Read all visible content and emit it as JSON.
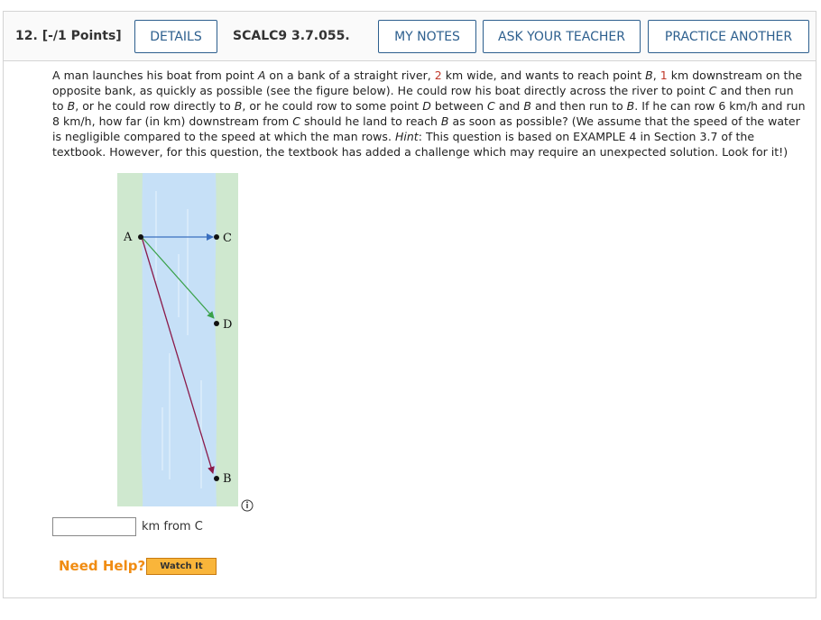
{
  "header": {
    "question_number": "12.",
    "points": "[-/1 Points]",
    "details_label": "DETAILS",
    "problem_code": "SCALC9 3.7.055.",
    "my_notes_label": "MY NOTES",
    "ask_teacher_label": "ASK YOUR TEACHER",
    "practice_label": "PRACTICE ANOTHER"
  },
  "question": {
    "p1": "A man launches his boat from point ",
    "pt_A": "A",
    "p2": " on a bank of a straight river, ",
    "width_km": "2",
    "p3": " km wide, and wants to reach point ",
    "pt_B": "B",
    "p4": ", ",
    "down_km": "1",
    "p5": " km downstream on the opposite bank, as quickly as possible (see the figure below). He could row his boat directly across the river to point ",
    "pt_C": "C",
    "p6": " and then run to ",
    "pt_B2": "B",
    "p7": ", or he could row directly to ",
    "pt_B3": "B",
    "p8": ", or he could row to some point ",
    "pt_D": "D",
    "p9": " between ",
    "pt_C2": "C",
    "p10": " and ",
    "pt_B4": "B",
    "p11": " and then run to ",
    "pt_B5": "B",
    "p12": ". If he can row 6 km/h and run 8 km/h, how far (in km) downstream from ",
    "pt_C3": "C",
    "p13": " should he land to reach ",
    "pt_B6": "B",
    "p14": " as soon as possible? (We assume that the speed of the water is negligible compared to the speed at which the man rows. ",
    "hint_label": "Hint",
    "p15": ": This question is based on EXAMPLE 4 in Section 3.7 of the textbook. However, for this question, the textbook has added a challenge which may require an unexpected solution. Look for it!)"
  },
  "figure": {
    "label_A": "A",
    "label_C": "C",
    "label_D": "D",
    "label_B": "B",
    "info_icon": "info-circle-icon",
    "colors": {
      "bank": "#cfe8cf",
      "water": "#c6e0f7",
      "arrow_AC": "#3a6fbf",
      "arrow_AD": "#3aa14a",
      "arrow_AB": "#8b1a4a"
    }
  },
  "answer": {
    "value": "",
    "unit_label": "km from C"
  },
  "help": {
    "need_help_label": "Need Help?",
    "watch_label": "Watch It"
  }
}
